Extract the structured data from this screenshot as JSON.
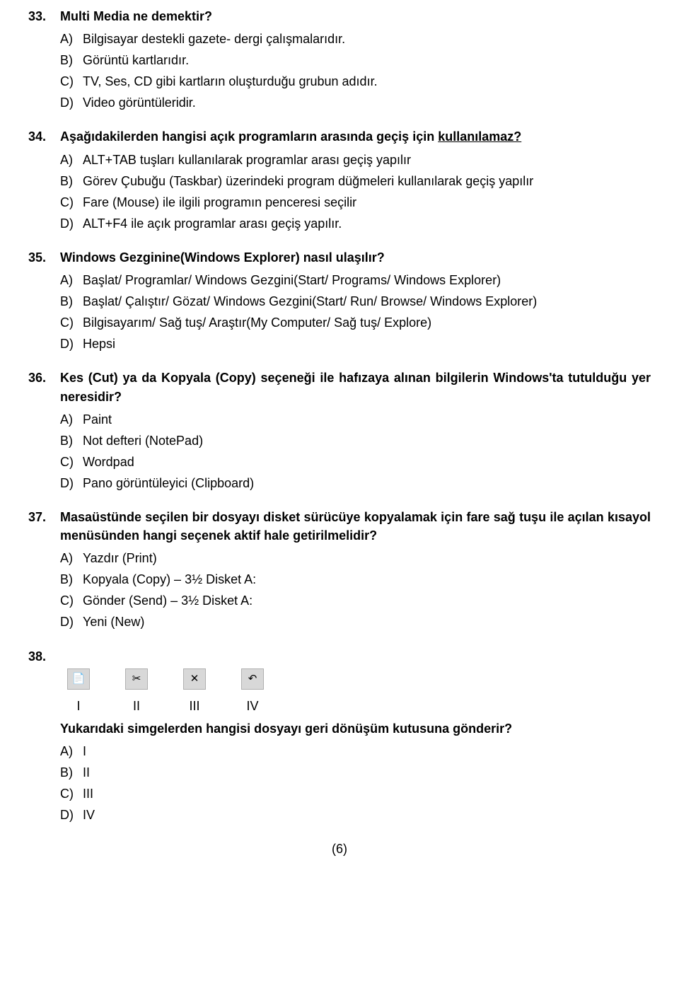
{
  "questions": {
    "q33": {
      "num": "33.",
      "text": "Multi Media ne demektir?",
      "opts": {
        "a": {
          "lbl": "A)",
          "txt": "Bilgisayar destekli gazete- dergi çalışmalarıdır."
        },
        "b": {
          "lbl": "B)",
          "txt": "Görüntü kartlarıdır."
        },
        "c": {
          "lbl": "C)",
          "txt": "TV, Ses, CD gibi kartların oluşturduğu grubun adıdır."
        },
        "d": {
          "lbl": "D)",
          "txt": "Video görüntüleridir."
        }
      }
    },
    "q34": {
      "num": "34.",
      "text_pre": "Aşağıdakilerden hangisi açık programların arasında geçiş için ",
      "text_under": "kullanılamaz?",
      "opts": {
        "a": {
          "lbl": "A)",
          "txt": "ALT+TAB tuşları kullanılarak programlar arası geçiş yapılır"
        },
        "b": {
          "lbl": "B)",
          "txt": "Görev Çubuğu (Taskbar) üzerindeki program düğmeleri kullanılarak geçiş yapılır"
        },
        "c": {
          "lbl": "C)",
          "txt": "Fare (Mouse) ile ilgili programın penceresi seçilir"
        },
        "d": {
          "lbl": "D)",
          "txt": "ALT+F4 ile açık programlar arası geçiş yapılır."
        }
      }
    },
    "q35": {
      "num": "35.",
      "text": "Windows Gezginine(Windows Explorer) nasıl ulaşılır?",
      "opts": {
        "a": {
          "lbl": "A)",
          "txt": "Başlat/ Programlar/ Windows Gezgini(Start/ Programs/ Windows Explorer)"
        },
        "b": {
          "lbl": "B)",
          "txt": "Başlat/ Çalıştır/ Gözat/ Windows Gezgini(Start/ Run/ Browse/ Windows Explorer)"
        },
        "c": {
          "lbl": "C)",
          "txt": "Bilgisayarım/ Sağ tuş/ Araştır(My Computer/ Sağ tuş/ Explore)"
        },
        "d": {
          "lbl": "D)",
          "txt": "Hepsi"
        }
      }
    },
    "q36": {
      "num": "36.",
      "text": "Kes (Cut) ya da Kopyala (Copy) seçeneği ile hafızaya alınan bilgilerin Windows'ta tutulduğu yer neresidir?",
      "opts": {
        "a": {
          "lbl": "A)",
          "txt": "Paint"
        },
        "b": {
          "lbl": "B)",
          "txt": "Not defteri (NotePad)"
        },
        "c": {
          "lbl": "C)",
          "txt": "Wordpad"
        },
        "d": {
          "lbl": "D)",
          "txt": "Pano görüntüleyici (Clipboard)"
        }
      }
    },
    "q37": {
      "num": "37.",
      "text": "Masaüstünde seçilen bir dosyayı disket sürücüye kopyalamak için fare sağ tuşu ile açılan kısayol menüsünden hangi seçenek aktif hale getirilmelidir?",
      "opts": {
        "a": {
          "lbl": "A)",
          "txt": "Yazdır (Print)"
        },
        "b": {
          "lbl": "B)",
          "txt": "Kopyala (Copy) – 3½ Disket A:"
        },
        "c": {
          "lbl": "C)",
          "txt": "Gönder (Send) – 3½ Disket A:"
        },
        "d": {
          "lbl": "D)",
          "txt": "Yeni (New)"
        }
      }
    },
    "q38": {
      "num": "38.",
      "icons": {
        "i1": {
          "glyph": "📄",
          "roman": "I"
        },
        "i2": {
          "glyph": "✂",
          "roman": "II"
        },
        "i3": {
          "glyph": "✕",
          "roman": "III"
        },
        "i4": {
          "glyph": "↶",
          "roman": "IV"
        }
      },
      "prompt": "Yukarıdaki simgelerden hangisi dosyayı geri dönüşüm kutusuna gönderir?",
      "opts": {
        "a": {
          "lbl": "A)",
          "txt": "I"
        },
        "b": {
          "lbl": "B)",
          "txt": "II"
        },
        "c": {
          "lbl": "C)",
          "txt": "III"
        },
        "d": {
          "lbl": "D)",
          "txt": "IV"
        }
      }
    }
  },
  "pagenum": "(6)"
}
